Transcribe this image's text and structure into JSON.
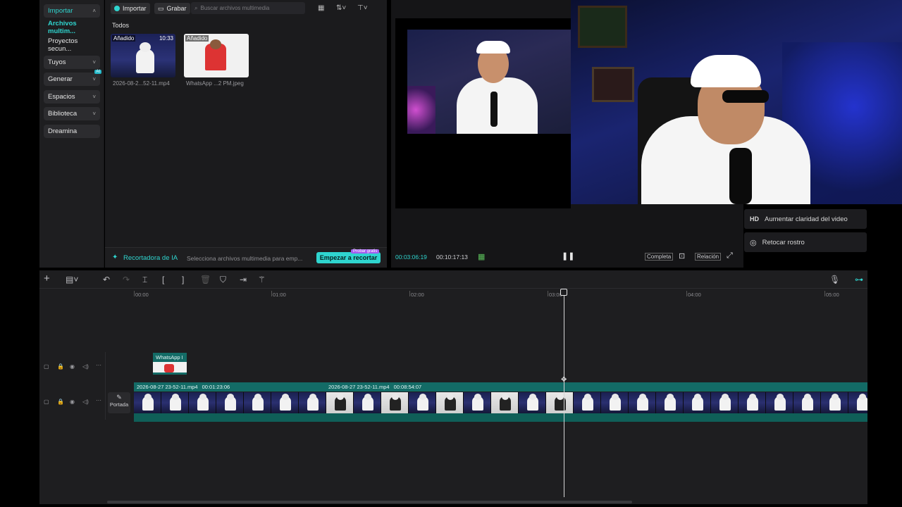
{
  "sidebar": {
    "items": [
      {
        "label": "Importar",
        "chevron": "˄"
      },
      {
        "label": "Archivos multim..."
      },
      {
        "label": "Proyectos secun..."
      },
      {
        "label": "Tuyos",
        "chevron": "˅"
      },
      {
        "label": "Generar",
        "chevron": "˅",
        "badge": "AI"
      },
      {
        "label": "Espacios",
        "chevron": "˅"
      },
      {
        "label": "Biblioteca",
        "chevron": "˅"
      },
      {
        "label": "Dreamina"
      }
    ]
  },
  "media": {
    "import_label": "Importar",
    "record_label": "Grabar",
    "search_placeholder": "Buscar archivos multimedia",
    "section_label": "Todos",
    "items": [
      {
        "badge": "Añadido",
        "duration": "10:33",
        "name": "2026-08-2...52-11.mp4"
      },
      {
        "badge": "Añadido",
        "duration": "",
        "name": "WhatsApp ...2 PM.jpeg"
      }
    ]
  },
  "ai_cutter": {
    "title": "Recortadora de IA",
    "hint": "Selecciona archivos multimedia para emp...",
    "button": "Empezar a recortar",
    "button_badge": "Probar gratis"
  },
  "player": {
    "current_time": "00:03:06:19",
    "total_time": "00:10:17:13",
    "full_label": "Completa",
    "ratio_label": "Relación"
  },
  "settings": {
    "items": [
      {
        "icon": "HD",
        "label": "Aumentar claridad del video"
      },
      {
        "icon": "face-retouch-icon",
        "label": "Retocar rostro"
      }
    ]
  },
  "timeline": {
    "ruler": [
      "00:00",
      "01:00",
      "02:00",
      "03:00",
      "04:00",
      "05:00"
    ],
    "overlay_clip": {
      "name": "WhatsApp I"
    },
    "main_clips": [
      {
        "name": "2026-08-27 23-52-11.mp4",
        "duration": "00:01:23:06"
      },
      {
        "name": "2026-08-27 23-52-11.mp4",
        "duration": "00:08:54:07"
      }
    ],
    "cover_label": "Portada"
  },
  "colors": {
    "accent": "#2fd5cf",
    "clip": "#136b66",
    "bg": "#1e1e20"
  }
}
